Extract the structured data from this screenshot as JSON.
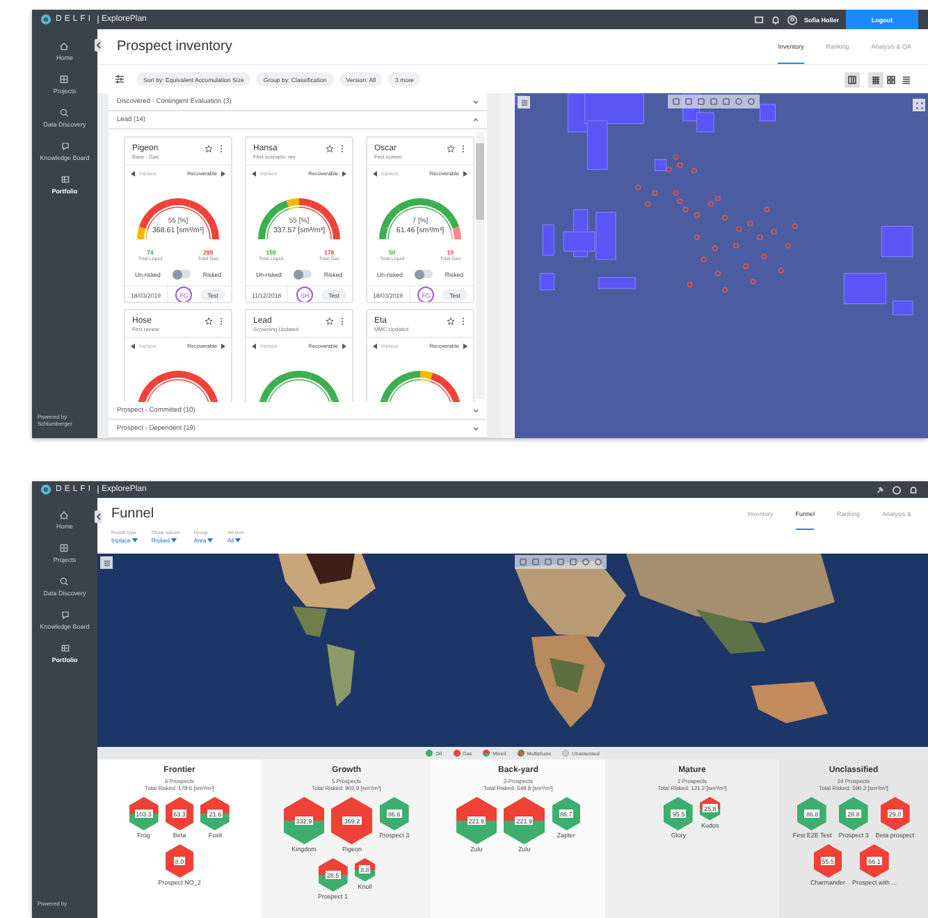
{
  "inventory_screen": {
    "brand": "DELFI",
    "app": "ExplorePlan",
    "user": "Sofia Holler",
    "logout": "Logout",
    "sidebar": [
      {
        "label": "Home",
        "kind": "home",
        "selected": false
      },
      {
        "label": "Projects",
        "kind": "projects",
        "selected": false
      },
      {
        "label": "Data Discovery",
        "kind": "search",
        "selected": false
      },
      {
        "label": "Knowledge Board",
        "kind": "board",
        "selected": false
      },
      {
        "label": "Portfolio",
        "kind": "portfolio",
        "selected": true
      }
    ],
    "sidebar_footer": [
      "Powered by",
      "Schlumberger"
    ],
    "title": "Prospect inventory",
    "tabs": [
      {
        "label": "Inventory",
        "selected": true
      },
      {
        "label": "Ranking",
        "selected": false
      },
      {
        "label": "Analysis & QA",
        "selected": false
      }
    ],
    "chips": [
      "Sort by: Equivalent Accumulation Size",
      "Group by: Classification",
      "Version: All",
      "3 more"
    ],
    "view_buttons": [
      {
        "kind": "map",
        "selected": true
      },
      {
        "kind": "grid",
        "selected": true
      },
      {
        "kind": "tiles",
        "selected": false
      },
      {
        "kind": "list",
        "selected": false
      }
    ],
    "groups_before": [
      {
        "label": "Discovered - Contingent Evaluation (3)",
        "expanded": false
      },
      {
        "label": "Lead (14)",
        "expanded": true
      }
    ],
    "cards": [
      {
        "name": "Pigeon",
        "subtitle": "Base - Gas",
        "nav_left": "Inplace",
        "nav_right": "Recoverable",
        "gauge": [
          {
            "color": "#f5b800"
          },
          {
            "color": "#ef4136"
          },
          {
            "color": "#ef4136"
          },
          {
            "color": "#ef4136"
          },
          {
            "color": "#ef4136"
          },
          {
            "color": "#ef4136"
          },
          {
            "color": "#ef4136"
          },
          {
            "color": "#ef4136"
          },
          {
            "color": "#ef4136"
          },
          {
            "color": "#ef4136"
          }
        ],
        "percent": "55",
        "percent_unit": "[%]",
        "volume": "368.61",
        "volume_unit": "[sm³/m³]",
        "liquid": "74",
        "liquid_label": "Total Liquid",
        "gas": "295",
        "gas_label": "Total Gas",
        "left_label": "Un-risked",
        "right_label": "Risked",
        "risked": false,
        "date": "18/03/2019",
        "badge": "FG",
        "tag": "Test"
      },
      {
        "name": "Hansa",
        "subtitle": "First scenario- rev",
        "nav_left": "Inplace",
        "nav_right": "Recoverable",
        "gauge": [
          {
            "color": "#3dae4f"
          },
          {
            "color": "#3dae4f"
          },
          {
            "color": "#3dae4f"
          },
          {
            "color": "#3dae4f"
          },
          {
            "color": "#f5b800"
          },
          {
            "color": "#ef4136"
          },
          {
            "color": "#ef4136"
          },
          {
            "color": "#ef4136"
          },
          {
            "color": "#ef4136"
          },
          {
            "color": "#ef4136"
          }
        ],
        "percent": "55",
        "percent_unit": "[%]",
        "volume": "337.57",
        "volume_unit": "[sm³/m³]",
        "liquid": "159",
        "liquid_label": "Total Liquid",
        "gas": "178",
        "gas_label": "Total Gas",
        "left_label": "Un-risked",
        "right_label": "Risked",
        "risked": false,
        "date": "11/12/2018",
        "badge": "SH",
        "tag": "Test"
      },
      {
        "name": "Oscar",
        "subtitle": "First screen",
        "nav_left": "Inplace",
        "nav_right": "Recoverable",
        "gauge": [
          {
            "color": "#3dae4f"
          },
          {
            "color": "#3dae4f"
          },
          {
            "color": "#3dae4f"
          },
          {
            "color": "#3dae4f"
          },
          {
            "color": "#3dae4f"
          },
          {
            "color": "#3dae4f"
          },
          {
            "color": "#3dae4f"
          },
          {
            "color": "#3dae4f"
          },
          {
            "color": "#3dae4f"
          },
          {
            "color": "#f28b8b"
          }
        ],
        "percent": "7",
        "percent_unit": "[%]",
        "volume": "61.46",
        "volume_unit": "[sm³/m³]",
        "liquid": "50",
        "liquid_label": "Total Liquid",
        "gas": "10",
        "gas_label": "Total Gas",
        "left_label": "Un-risked",
        "right_label": "Risked",
        "risked": false,
        "date": "18/03/2019",
        "badge": "FG",
        "tag": "Test"
      },
      {
        "name": "Hose",
        "subtitle": "First review",
        "nav_left": "Inplace",
        "nav_right": "Recoverable",
        "gauge": [
          {
            "color": "#ef4136"
          },
          {
            "color": "#ef4136"
          },
          {
            "color": "#ef4136"
          },
          {
            "color": "#ef4136"
          },
          {
            "color": "#ef4136"
          },
          {
            "color": "#ef4136"
          },
          {
            "color": "#ef4136"
          },
          {
            "color": "#ef4136"
          },
          {
            "color": "#ef4136"
          },
          {
            "color": "#ef4136"
          }
        ]
      },
      {
        "name": "Lead",
        "subtitle": "Screening Updated",
        "nav_left": "Inplace",
        "nav_right": "Recoverable",
        "gauge": [
          {
            "color": "#3dae4f"
          },
          {
            "color": "#3dae4f"
          },
          {
            "color": "#3dae4f"
          },
          {
            "color": "#3dae4f"
          },
          {
            "color": "#3dae4f"
          },
          {
            "color": "#3dae4f"
          },
          {
            "color": "#3dae4f"
          },
          {
            "color": "#3dae4f"
          },
          {
            "color": "#3dae4f"
          },
          {
            "color": "#3dae4f"
          }
        ]
      },
      {
        "name": "Eta",
        "subtitle": "MMC Updated",
        "nav_left": "Inplace",
        "nav_right": "Recoverable",
        "gauge": [
          {
            "color": "#3dae4f"
          },
          {
            "color": "#3dae4f"
          },
          {
            "color": "#3dae4f"
          },
          {
            "color": "#3dae4f"
          },
          {
            "color": "#3dae4f"
          },
          {
            "color": "#f5b800"
          },
          {
            "color": "#ef4136"
          },
          {
            "color": "#ef4136"
          },
          {
            "color": "#ef4136"
          },
          {
            "color": "#ef4136"
          }
        ]
      }
    ],
    "groups_after": [
      {
        "label": "Prospect - Committed (10)",
        "expanded": false
      },
      {
        "label": "Prospect - Dependent (19)",
        "expanded": false
      }
    ]
  },
  "funnel_screen": {
    "brand": "DELFI",
    "app": "ExplorePlan",
    "sidebar": [
      {
        "label": "Home",
        "kind": "home",
        "selected": false
      },
      {
        "label": "Projects",
        "kind": "projects",
        "selected": false
      },
      {
        "label": "Data Discovery",
        "kind": "search",
        "selected": false
      },
      {
        "label": "Knowledge Board",
        "kind": "board",
        "selected": false
      },
      {
        "label": "Portfolio",
        "kind": "portfolio",
        "selected": true
      }
    ],
    "sidebar_footer": [
      "Powered by"
    ],
    "title": "Funnel",
    "tabs": [
      {
        "label": "Inventory",
        "selected": false
      },
      {
        "label": "Funnel",
        "selected": true
      },
      {
        "label": "Ranking",
        "selected": false
      },
      {
        "label": "Analysis &",
        "selected": false
      }
    ],
    "filters": [
      {
        "label": "Result type",
        "value": "Inplace"
      },
      {
        "label": "Show values",
        "value": "Risked"
      },
      {
        "label": "Group",
        "value": "Area"
      },
      {
        "label": "Version",
        "value": "All"
      }
    ],
    "legend": [
      {
        "label": "Oil",
        "kind": "oil"
      },
      {
        "label": "Gas",
        "kind": "gas"
      },
      {
        "label": "Mixed",
        "kind": "mixed"
      },
      {
        "label": "Multiphase",
        "kind": "multiphase"
      },
      {
        "label": "Unassessed",
        "kind": "unassessed"
      }
    ],
    "columns": [
      {
        "title": "Frontier",
        "count": "6 Prospects",
        "total": "Total Risked: 178.6 [sm³/m³]",
        "rows": [
          {
            "prospects": [
              {
                "name": "Frog",
                "value": "103.3",
                "kind": "mixed",
                "large": false,
                "small": false
              },
              {
                "name": "Beta",
                "value": "63.3",
                "kind": "gas",
                "large": false,
                "small": false
              },
              {
                "name": "Foxit",
                "value": "21.6",
                "kind": "mixed",
                "large": false,
                "small": false
              }
            ]
          },
          {
            "prospects": [
              {
                "name": "Prospect NO_2",
                "value": "8.0",
                "kind": "gas",
                "large": false,
                "small": false
              }
            ]
          }
        ]
      },
      {
        "title": "Growth",
        "count": "5 Prospects",
        "total": "Total Risked: 902.9 [sm³/m³]",
        "rows": [
          {
            "prospects": [
              {
                "name": "Kingdom",
                "value": "332.9",
                "kind": "mixed",
                "large": true,
                "small": false
              },
              {
                "name": "Pigeon",
                "value": "369.2",
                "kind": "gas",
                "large": true,
                "small": false
              },
              {
                "name": "Prospect 3",
                "value": "86.6",
                "kind": "oil",
                "large": false,
                "small": false
              }
            ]
          },
          {
            "prospects": [
              {
                "name": "Prospect 1",
                "value": "28.5",
                "kind": "mixed",
                "large": false,
                "small": false
              },
              {
                "name": "Knoll",
                "value": "8.8",
                "kind": "mixed",
                "large": false,
                "small": true
              }
            ]
          }
        ]
      },
      {
        "title": "Back-yard",
        "count": "3 Prospects",
        "total": "Total Risked: 548.8 [sm³/m³]",
        "rows": [
          {
            "prospects": [
              {
                "name": "Zulu",
                "value": "221.9",
                "kind": "mixed",
                "large": true,
                "small": false
              },
              {
                "name": "Zulu",
                "value": "221.9",
                "kind": "mixed",
                "large": true,
                "small": false
              },
              {
                "name": "Zapter",
                "value": "86.7",
                "kind": "oil",
                "large": false,
                "small": false
              }
            ]
          }
        ]
      },
      {
        "title": "Mature",
        "count": "2 Prospects",
        "total": "Total Risked: 121.2 [sm³/m³]",
        "rows": [
          {
            "prospects": [
              {
                "name": "Glory",
                "value": "95.5",
                "kind": "oil",
                "large": false,
                "small": false
              },
              {
                "name": "Kudos",
                "value": "25.8",
                "kind": "mixed",
                "large": false,
                "small": true
              }
            ]
          }
        ]
      },
      {
        "title": "Unclassified",
        "count": "24 Prospects",
        "total": "Total Risked: 590.3 [sm³/m³]",
        "rows": [
          {
            "prospects": [
              {
                "name": "First E2E Test",
                "value": "86.8",
                "kind": "oil",
                "large": false,
                "small": false
              },
              {
                "name": "Prospect 3",
                "value": "28.8",
                "kind": "oil",
                "large": false,
                "small": false
              },
              {
                "name": "Beta prospect",
                "value": "29.0",
                "kind": "gas",
                "large": false,
                "small": false
              }
            ]
          },
          {
            "prospects": [
              {
                "name": "Charmander",
                "value": "55.5",
                "kind": "gas",
                "large": false,
                "small": false
              },
              {
                "name": "Prospect with ...",
                "value": "66.1",
                "kind": "gas",
                "large": false,
                "small": false
              }
            ]
          }
        ]
      }
    ]
  }
}
